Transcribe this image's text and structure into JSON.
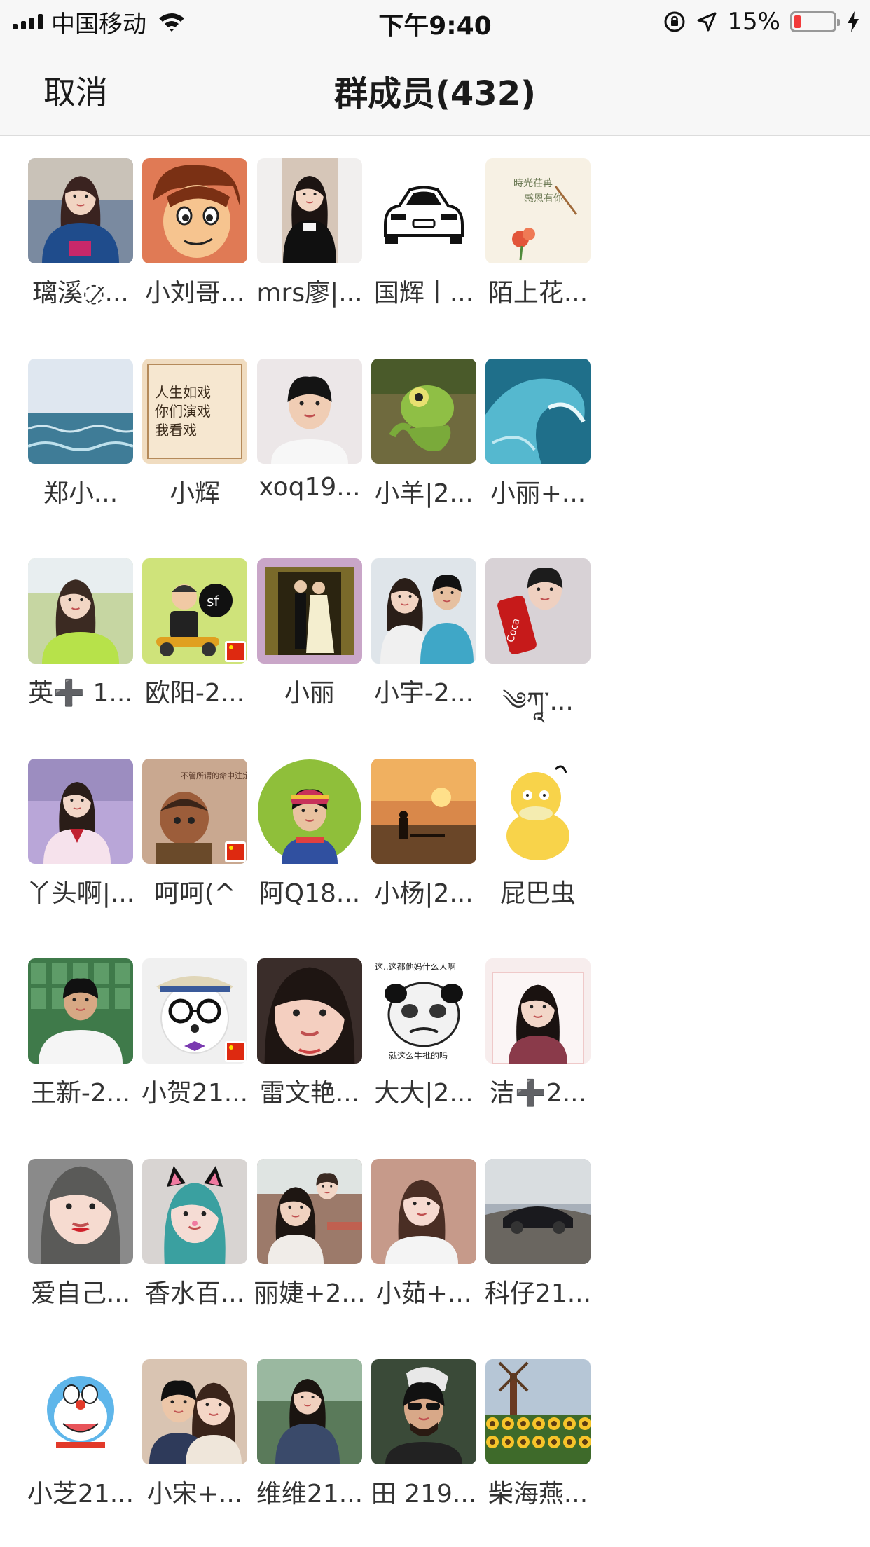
{
  "status_bar": {
    "carrier": "中国移动",
    "time": "下午9:40",
    "battery_percent_text": "15%",
    "battery_level": 0.15,
    "battery_color": "#f23b3b"
  },
  "nav": {
    "cancel_label": "取消",
    "title": "群成员(432)"
  },
  "members": [
    {
      "name": "璃溪◌̷...",
      "avatar": "photo-girl-blue-jacket"
    },
    {
      "name": "小刘哥...",
      "avatar": "cartoon-boy"
    },
    {
      "name": "mrs廖|...",
      "avatar": "photo-girl-black"
    },
    {
      "name": "国辉丨...",
      "avatar": "car-drawing"
    },
    {
      "name": "陌上花...",
      "avatar": "flower-note"
    },
    {
      "name": "郑小...",
      "avatar": "sea"
    },
    {
      "name": "小辉",
      "avatar": "handwriting-note"
    },
    {
      "name": "xoq19...",
      "avatar": "photo-boy"
    },
    {
      "name": "小羊|2...",
      "avatar": "cartoon-chameleon"
    },
    {
      "name": "小丽+...",
      "avatar": "wave"
    },
    {
      "name": "英➕ 1...",
      "avatar": "photo-girl-green"
    },
    {
      "name": "欧阳-2...",
      "avatar": "cartoon-courier"
    },
    {
      "name": "小丽",
      "avatar": "wedding-photo"
    },
    {
      "name": "小宇-2...",
      "avatar": "photo-couple"
    },
    {
      "name": "༄ཀཱ་...",
      "avatar": "photo-boy-cola"
    },
    {
      "name": "丫头啊|...",
      "avatar": "photo-girl-pink"
    },
    {
      "name": "呵呵(^",
      "avatar": "cartoon-boy-brown"
    },
    {
      "name": "阿Q18...",
      "avatar": "photo-boy-hat-round"
    },
    {
      "name": "小杨|2...",
      "avatar": "sunset-silhouette"
    },
    {
      "name": "屁巴虫",
      "avatar": "cartoon-duck"
    },
    {
      "name": "王新-2...",
      "avatar": "photo-man"
    },
    {
      "name": "小贺21...",
      "avatar": "dog-glasses"
    },
    {
      "name": "雷文艳...",
      "avatar": "photo-girl-face"
    },
    {
      "name": "大大|2...",
      "avatar": "panda-meme"
    },
    {
      "name": "洁➕2...",
      "avatar": "photo-girl-frame"
    },
    {
      "name": "爱自己...",
      "avatar": "photo-girl-red-lips"
    },
    {
      "name": "香水百...",
      "avatar": "photo-girl-cat-ears"
    },
    {
      "name": "丽婕+2...",
      "avatar": "photo-mother-child"
    },
    {
      "name": "小茹+...",
      "avatar": "photo-girl-smile"
    },
    {
      "name": "科仔21...",
      "avatar": "sports-car"
    },
    {
      "name": "小芝21...",
      "avatar": "cartoon-doraemon"
    },
    {
      "name": "小宋+...",
      "avatar": "photo-couple-2"
    },
    {
      "name": "维维21...",
      "avatar": "photo-woman-outdoor"
    },
    {
      "name": "田 219...",
      "avatar": "photo-man-sunglasses"
    },
    {
      "name": "柴海燕...",
      "avatar": "sunflowers-windmill"
    }
  ]
}
